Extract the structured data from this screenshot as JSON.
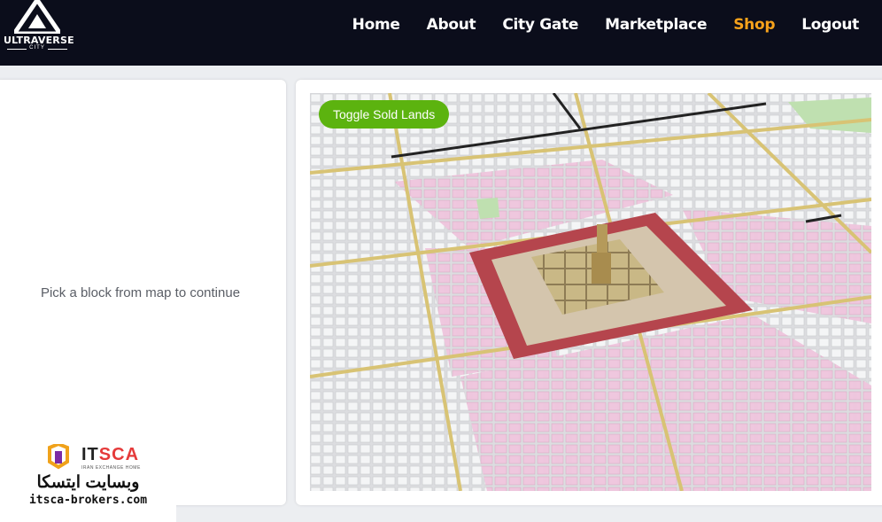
{
  "brand": {
    "name": "ULTRAVERSE",
    "sub": "CITY"
  },
  "nav": [
    {
      "label": "Home"
    },
    {
      "label": "About"
    },
    {
      "label": "City Gate"
    },
    {
      "label": "Marketplace"
    },
    {
      "label": "Shop",
      "active": true
    },
    {
      "label": "Logout"
    }
  ],
  "left_panel": {
    "message": "Pick a block from map to continue"
  },
  "map": {
    "toggle_label": "Toggle Sold Lands"
  },
  "watermark": {
    "brand": "IT",
    "brand_mark": "SCA",
    "tagline": "IRAN EXCHANGE HOME",
    "farsi": "وبسایت ایتسکا",
    "url": "itsca-brokers.com"
  },
  "colors": {
    "nav_bg": "#0b0d1b",
    "active_nav": "#f7a21b",
    "toggle_bg": "#5cb30f",
    "sold_land": "#efc5dd",
    "center_ring": "#b5454d"
  }
}
